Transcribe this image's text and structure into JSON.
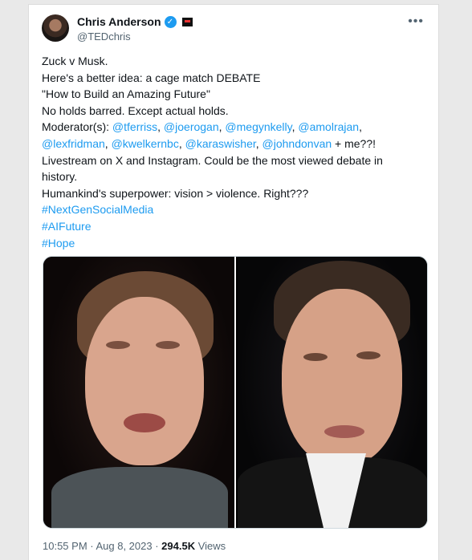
{
  "author": {
    "name": "Chris Anderson",
    "handle": "@TEDchris"
  },
  "more_label": "•••",
  "tweet_lines": [
    [
      {
        "t": "Zuck v Musk."
      }
    ],
    [
      {
        "t": "Here's a better idea: a cage match DEBATE"
      }
    ],
    [
      {
        "t": "\"How to Build an Amazing Future\""
      }
    ],
    [
      {
        "t": "No holds barred. Except actual holds."
      }
    ],
    [
      {
        "t": "Moderator(s): "
      },
      {
        "t": "@tferriss",
        "link": true
      },
      {
        "t": ", "
      },
      {
        "t": "@joerogan",
        "link": true
      },
      {
        "t": ", "
      },
      {
        "t": "@megynkelly",
        "link": true
      },
      {
        "t": ", "
      },
      {
        "t": "@amolrajan",
        "link": true
      },
      {
        "t": ","
      }
    ],
    [
      {
        "t": "@lexfridman",
        "link": true
      },
      {
        "t": ", "
      },
      {
        "t": "@kwelkernbc",
        "link": true
      },
      {
        "t": ", "
      },
      {
        "t": "@karaswisher",
        "link": true
      },
      {
        "t": ", "
      },
      {
        "t": "@johndonvan",
        "link": true
      },
      {
        "t": " + me??!"
      }
    ],
    [
      {
        "t": "Livestream on X and Instagram. Could be the most viewed debate in"
      }
    ],
    [
      {
        "t": "history."
      }
    ],
    [
      {
        "t": "Humankind's superpower: vision > violence. Right???"
      }
    ],
    [
      {
        "t": "#NextGenSocialMedia",
        "link": true
      }
    ],
    [
      {
        "t": "#AIFuture",
        "link": true
      }
    ],
    [
      {
        "t": "#Hope",
        "link": true
      }
    ]
  ],
  "meta": {
    "time": "10:55 PM · Aug 8, 2023 · ",
    "views_count": "294.5K",
    "views_label": " Views"
  },
  "colors": {
    "link": "#1d9bf0",
    "text": "#0f1419",
    "muted": "#536471"
  }
}
